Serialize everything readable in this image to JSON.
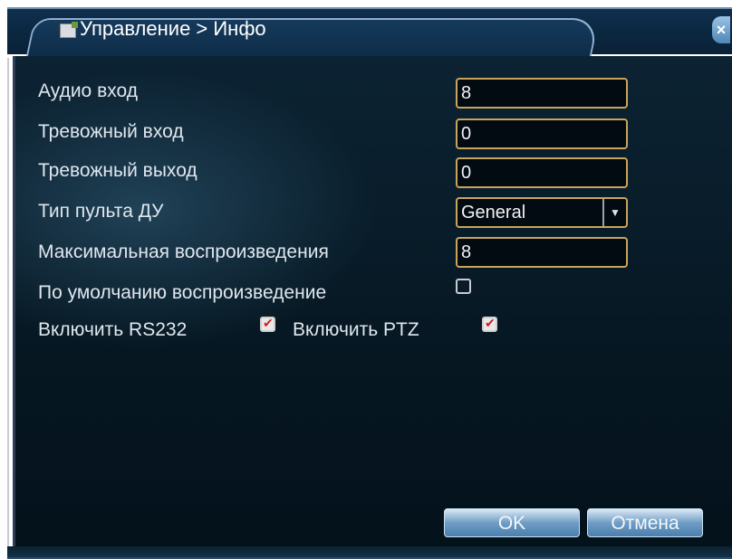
{
  "window": {
    "title": "Управление > Инфо",
    "close_label": "×"
  },
  "fields": {
    "audio_in": {
      "label": "Аудио вход",
      "value": "8"
    },
    "alarm_in": {
      "label": "Тревожный вход",
      "value": "0"
    },
    "alarm_out": {
      "label": "Тревожный выход",
      "value": "0"
    },
    "remote_type": {
      "label": "Тип пульта ДУ",
      "value": "General"
    },
    "max_playback": {
      "label": "Максимальная воспроизведения",
      "value": "8"
    },
    "default_playback": {
      "label": "По умолчанию воспроизведение",
      "checked": false
    },
    "rs232": {
      "label": "Включить RS232",
      "checked": true
    },
    "ptz": {
      "label": "Включить PTZ",
      "checked": true
    }
  },
  "buttons": {
    "ok": "OK",
    "cancel": "Отмена"
  },
  "colors": {
    "panel_bg": "#061722",
    "title_bg": "#0d2b46",
    "field_border": "#c9a55a",
    "check_mark": "#d21e1e"
  }
}
